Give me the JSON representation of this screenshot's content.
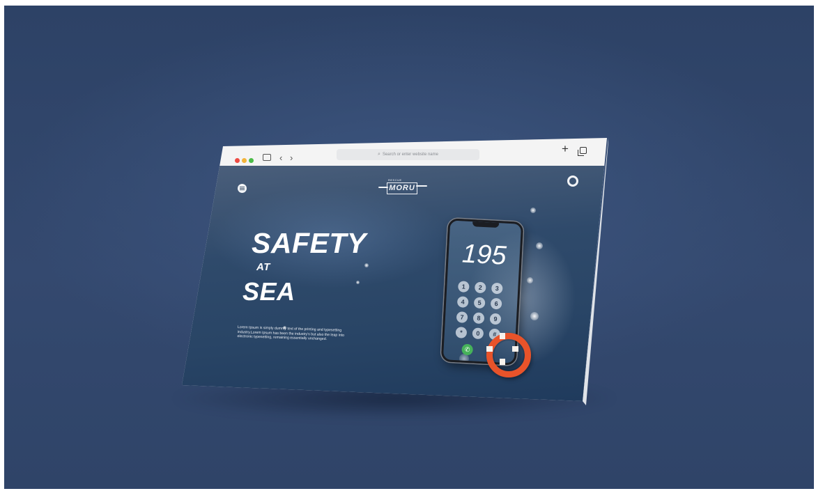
{
  "browser": {
    "address_placeholder": "Search or enter website name",
    "controls": {
      "new_tab": "+",
      "back": "‹",
      "forward": "›"
    }
  },
  "site": {
    "logo_text": "MORU",
    "logo_top_text": "RESCUE",
    "headline": {
      "line1": "SAFETY",
      "line2": "AT",
      "line3": "SEA"
    },
    "description": "Lorem Ipsum is simply dummy text of the printing and typesetting industry.Lorem Ipsum has been the industry's but also the leap into electronic typesetting, remaining essentially unchanged.",
    "phone": {
      "number": "195",
      "keys": [
        "1",
        "2",
        "3",
        "4",
        "5",
        "6",
        "7",
        "8",
        "9",
        "*",
        "0",
        "#"
      ]
    }
  },
  "colors": {
    "background": "#34496f",
    "accent_red": "#e8532a",
    "traffic_red": "#ee4b43",
    "traffic_yellow": "#f3b43a",
    "traffic_green": "#4bbc48",
    "call_green": "#46b25a"
  },
  "icons": [
    "menu-icon",
    "lifebuoy-icon",
    "tab-overview-icon",
    "back-icon",
    "forward-icon",
    "search-icon",
    "plus-icon",
    "copy-tabs-icon",
    "phone-call-icon"
  ]
}
